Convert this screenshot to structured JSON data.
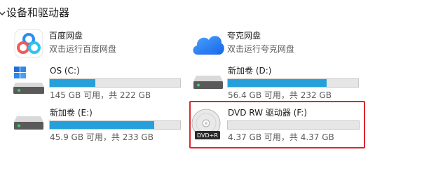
{
  "section": {
    "title": "设备和驱动器"
  },
  "items": [
    {
      "name": "百度网盘",
      "subtitle": "双击运行百度网盘",
      "icon": "baidu-netdisk-icon"
    },
    {
      "name": "夸克网盘",
      "subtitle": "双击运行夸克网盘",
      "icon": "quark-cloud-icon"
    },
    {
      "name": "OS (C:)",
      "free_text": "145 GB 可用，共 222 GB",
      "used_fraction": 0.35,
      "icon": "windows-drive-icon"
    },
    {
      "name": "新加卷 (D:)",
      "free_text": "56.4 GB 可用，共 232 GB",
      "used_fraction": 0.76,
      "icon": "hard-drive-icon"
    },
    {
      "name": "新加卷 (E:)",
      "free_text": "45.9 GB 可用，共 233 GB",
      "used_fraction": 0.8,
      "icon": "hard-drive-icon"
    },
    {
      "name": "DVD RW 驱动器 (F:)",
      "free_text": "4.37 GB 可用，共 4.37 GB",
      "used_fraction": 0.0,
      "icon": "dvd-drive-icon",
      "disc_label": "DVD+R"
    }
  ],
  "colors": {
    "bar_fill": "#26a0da",
    "bar_track": "#e6e6e6",
    "selection_border": "#e0262b"
  }
}
